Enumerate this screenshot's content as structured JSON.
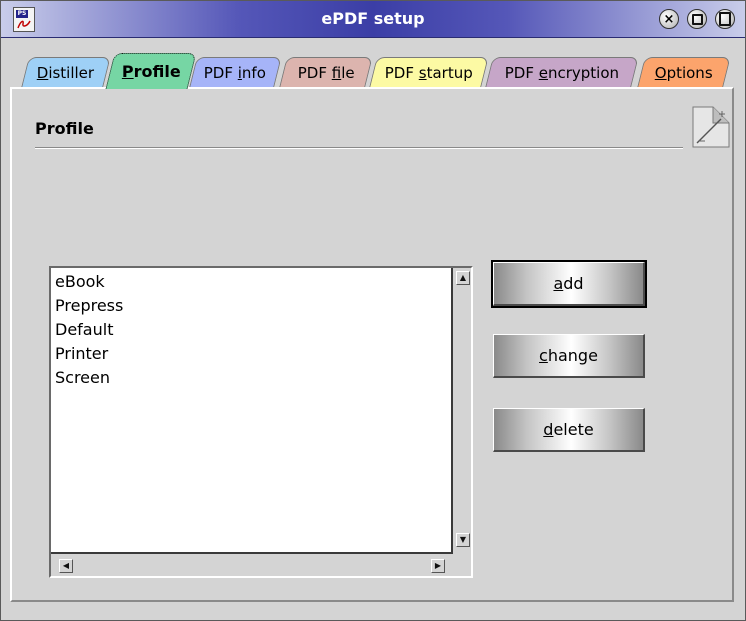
{
  "window": {
    "title": "ePDF setup"
  },
  "titlebar_buttons": [
    {
      "name": "close-icon"
    },
    {
      "name": "minimize-icon"
    },
    {
      "name": "maximize-icon"
    }
  ],
  "tabs": [
    {
      "label": "Distiller",
      "key": "D",
      "rest": "istiller",
      "color": "#9ed0f6",
      "active": false
    },
    {
      "label": "Profile",
      "key": "P",
      "rest": "rofile",
      "color": "#76d6a4",
      "active": true
    },
    {
      "label": "PDF info",
      "pre": "PDF ",
      "key": "i",
      "rest": "nfo",
      "color": "#a6b4f8",
      "active": false
    },
    {
      "label": "PDF file",
      "pre": "PDF ",
      "key": "f",
      "rest": "ile",
      "color": "#dcb4ae",
      "active": false
    },
    {
      "label": "PDF startup",
      "pre": "PDF ",
      "key": "s",
      "rest": "tartup",
      "color": "#fcfaa4",
      "active": false
    },
    {
      "label": "PDF encryption",
      "pre": "PDF ",
      "key": "e",
      "rest": "ncryption",
      "color": "#c6a6c8",
      "active": false
    },
    {
      "label": "Options",
      "key": "O",
      "rest": "ptions",
      "color": "#fca46c",
      "active": false
    }
  ],
  "page": {
    "title": "Profile"
  },
  "profiles": {
    "items": [
      "eBook",
      "Prepress",
      "Default",
      "Printer",
      "Screen"
    ]
  },
  "buttons": {
    "add": {
      "key": "a",
      "rest": "dd",
      "label": "add"
    },
    "change": {
      "key": "c",
      "rest": "hange",
      "label": "change"
    },
    "delete": {
      "key": "d",
      "rest": "elete",
      "label": "delete"
    }
  }
}
